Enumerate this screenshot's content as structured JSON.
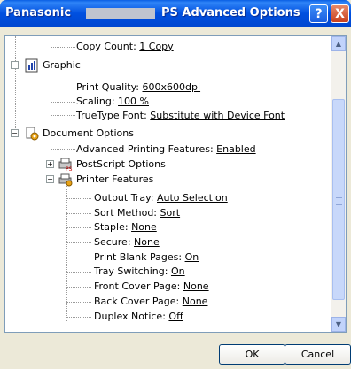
{
  "window": {
    "title_left": "Panasonic",
    "title_right": "PS Advanced Options",
    "help_label": "?",
    "close_label": "X"
  },
  "tree": {
    "copy_count": {
      "label": "Copy Count:",
      "value": "1 Copy"
    },
    "graphic": {
      "label": "Graphic"
    },
    "print_quality": {
      "label": "Print Quality:",
      "value": "600x600dpi"
    },
    "scaling": {
      "label": "Scaling:",
      "value": "100 %"
    },
    "truetype_font": {
      "label": "TrueType Font:",
      "value": "Substitute with Device Font"
    },
    "document_options": {
      "label": "Document Options"
    },
    "advanced_printing": {
      "label": "Advanced Printing Features:",
      "value": "Enabled"
    },
    "postscript_options": {
      "label": "PostScript Options"
    },
    "printer_features": {
      "label": "Printer Features"
    },
    "output_tray": {
      "label": "Output Tray:",
      "value": "Auto Selection"
    },
    "sort_method": {
      "label": "Sort Method:",
      "value": "Sort"
    },
    "staple": {
      "label": "Staple:",
      "value": "None"
    },
    "secure": {
      "label": "Secure:",
      "value": "None"
    },
    "print_blank_pages": {
      "label": "Print Blank Pages:",
      "value": "On"
    },
    "tray_switching": {
      "label": "Tray Switching:",
      "value": "On"
    },
    "front_cover_page": {
      "label": "Front Cover Page:",
      "value": "None"
    },
    "back_cover_page": {
      "label": "Back Cover Page:",
      "value": "None"
    },
    "duplex_notice": {
      "label": "Duplex Notice:",
      "value": "Off"
    }
  },
  "buttons": {
    "ok": "OK",
    "cancel": "Cancel"
  }
}
